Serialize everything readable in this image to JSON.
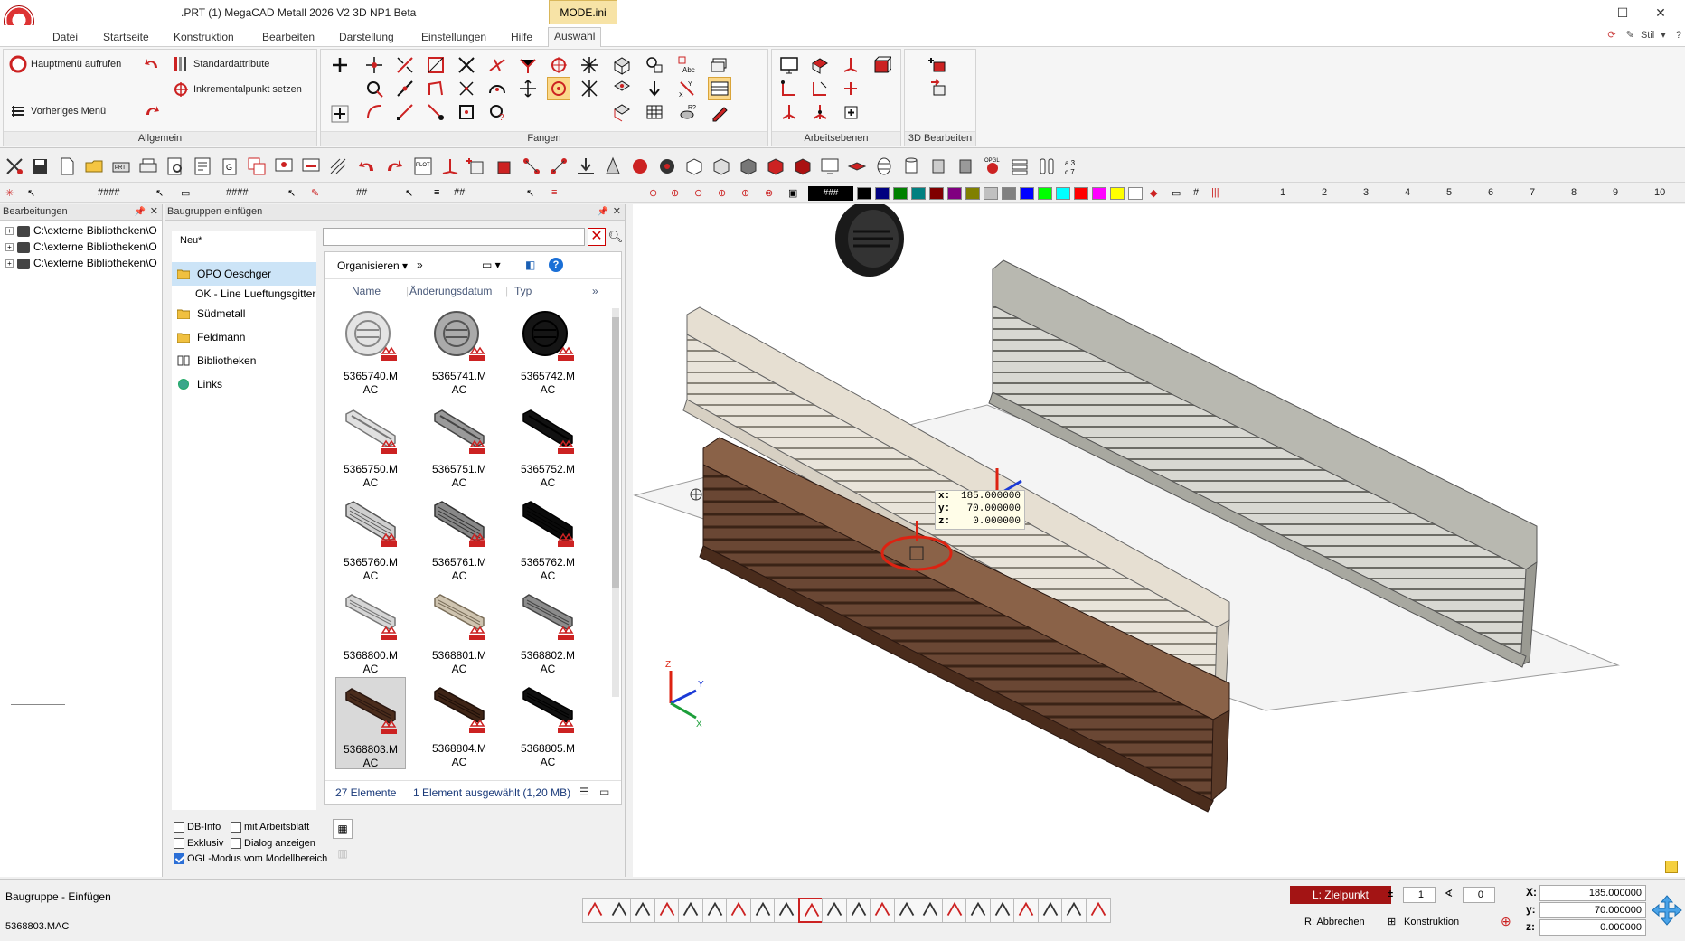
{
  "window": {
    "title": ".PRT (1) MegaCAD Metall 2026 V2 3D NP1 Beta",
    "mode_tab": "MODE.ini",
    "logo_text": "MegaCAD",
    "controls": [
      "—",
      "☐",
      "✕"
    ]
  },
  "menu": {
    "tabs": [
      "Datei",
      "Startseite",
      "Konstruktion",
      "Bearbeiten",
      "Darstellung",
      "Einstellungen",
      "Hilfe",
      "Auswahl"
    ],
    "active": "Auswahl",
    "right": "Stil"
  },
  "ribbon": {
    "allgemein": {
      "label": "Allgemein",
      "hauptmenu": "Hauptmenü aufrufen",
      "standardattribute": "Standardattribute",
      "inkrementalpunkt": "Inkrementalpunkt setzen",
      "vorheriges": "Vorheriges Menü"
    },
    "fangen": {
      "label": "Fangen"
    },
    "arbeitsebenen": {
      "label": "Arbeitsebenen"
    },
    "bearbeiten3d": {
      "label": "3D Bearbeiten"
    }
  },
  "toolbar2": {
    "hash1": "####",
    "hash2": "####",
    "hash3": "##",
    "hash4": "###",
    "hash5": "##",
    "colors": [
      "#000000",
      "#000080",
      "#008000",
      "#008080",
      "#800000",
      "#800080",
      "#808000",
      "#c0c0c0",
      "#808080",
      "#0000ff",
      "#00ff00",
      "#00ffff",
      "#ff0000",
      "#ff00ff",
      "#ffff00",
      "#ffffff"
    ],
    "numbers": [
      "1",
      "2",
      "3",
      "4",
      "5",
      "6",
      "7",
      "8",
      "9",
      "10"
    ]
  },
  "left_panel": {
    "title": "Bearbeitungen",
    "items": [
      "C:\\externe Bibliotheken\\O",
      "C:\\externe Bibliotheken\\O",
      "C:\\externe Bibliotheken\\O"
    ]
  },
  "mid_panel": {
    "title": "Baugruppen einfügen",
    "neu": "Neu*",
    "nav": [
      {
        "label": "OPO Oeschger",
        "selected": true
      },
      {
        "label": "OK - Line Lueftungsgitter",
        "selected": false
      },
      {
        "label": "Südmetall",
        "selected": false
      },
      {
        "label": "Feldmann",
        "selected": false
      },
      {
        "label": "Bibliotheken",
        "selected": false
      },
      {
        "label": "Links",
        "selected": false
      }
    ],
    "organize": "Organisieren",
    "more": "»",
    "columns": [
      "Name",
      "Änderungsdatum",
      "Typ"
    ],
    "files": [
      {
        "name": "5365740.M",
        "ext": "AC",
        "style": "round-light"
      },
      {
        "name": "5365741.M",
        "ext": "AC",
        "style": "round-grey"
      },
      {
        "name": "5365742.M",
        "ext": "AC",
        "style": "round-black"
      },
      {
        "name": "5365750.M",
        "ext": "AC",
        "style": "bar-light"
      },
      {
        "name": "5365751.M",
        "ext": "AC",
        "style": "bar-grey"
      },
      {
        "name": "5365752.M",
        "ext": "AC",
        "style": "bar-black"
      },
      {
        "name": "5365760.M",
        "ext": "AC",
        "style": "grid-light"
      },
      {
        "name": "5365761.M",
        "ext": "AC",
        "style": "grid-grey"
      },
      {
        "name": "5365762.M",
        "ext": "AC",
        "style": "grid-black"
      },
      {
        "name": "5368800.M",
        "ext": "AC",
        "style": "long-light"
      },
      {
        "name": "5368801.M",
        "ext": "AC",
        "style": "long-beige"
      },
      {
        "name": "5368802.M",
        "ext": "AC",
        "style": "long-grey"
      },
      {
        "name": "5368803.M",
        "ext": "AC",
        "style": "long-brown",
        "selected": true
      },
      {
        "name": "5368804.M",
        "ext": "AC",
        "style": "long-brown2"
      },
      {
        "name": "5368805.M",
        "ext": "AC",
        "style": "long-black"
      }
    ],
    "status_count": "27 Elemente",
    "status_selection": "1 Element ausgewählt (1,20 MB)",
    "options": [
      {
        "label": "DB-Info",
        "checked": false
      },
      {
        "label": "mit Arbeitsblatt",
        "checked": false
      },
      {
        "label": "Exklusiv",
        "checked": false
      },
      {
        "label": "Dialog anzeigen",
        "checked": false
      },
      {
        "label": "OGL-Modus vom Modellbereich",
        "checked": true
      }
    ]
  },
  "viewport": {
    "coords": {
      "x": "185.000000",
      "y": "70.000000",
      "z": "0.000000"
    },
    "axis": {
      "x": "X",
      "y": "Y",
      "z": "Z"
    }
  },
  "statusbar": {
    "title": "Baugruppe - Einfügen",
    "file": "5368803.MAC",
    "zielpunkt": "L: Zielpunkt",
    "abbrechen": "R: Abbrechen",
    "konstruktion": "Konstruktion",
    "spin1": "1",
    "spin2": "0",
    "x": "185.000000",
    "y": "70.000000",
    "z": "0.000000"
  }
}
